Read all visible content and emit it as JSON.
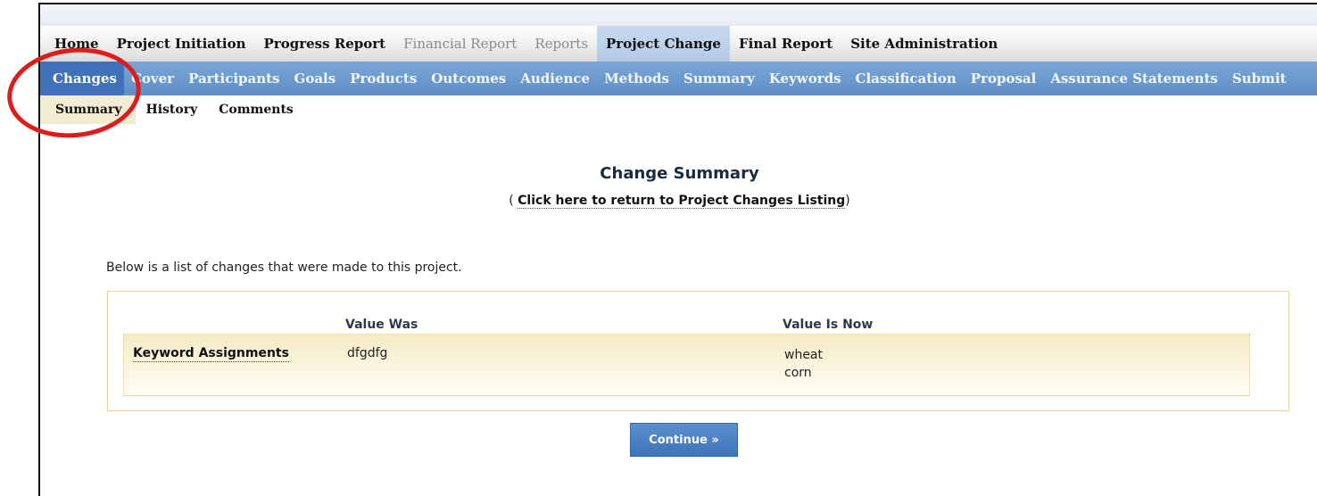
{
  "main_nav": [
    {
      "label": "Home",
      "state": "normal"
    },
    {
      "label": "Project Initiation",
      "state": "normal"
    },
    {
      "label": "Progress Report",
      "state": "normal"
    },
    {
      "label": "Financial Report",
      "state": "disabled"
    },
    {
      "label": "Reports",
      "state": "disabled"
    },
    {
      "label": "Project Change",
      "state": "active"
    },
    {
      "label": "Final Report",
      "state": "normal"
    },
    {
      "label": "Site Administration",
      "state": "normal"
    }
  ],
  "sub_nav": [
    {
      "label": "Changes",
      "active": true
    },
    {
      "label": "Cover",
      "active": false
    },
    {
      "label": "Participants",
      "active": false
    },
    {
      "label": "Goals",
      "active": false
    },
    {
      "label": "Products",
      "active": false
    },
    {
      "label": "Outcomes",
      "active": false
    },
    {
      "label": "Audience",
      "active": false
    },
    {
      "label": "Methods",
      "active": false
    },
    {
      "label": "Summary",
      "active": false
    },
    {
      "label": "Keywords",
      "active": false
    },
    {
      "label": "Classification",
      "active": false
    },
    {
      "label": "Proposal",
      "active": false
    },
    {
      "label": "Assurance Statements",
      "active": false
    },
    {
      "label": "Submit",
      "active": false
    }
  ],
  "tabs": [
    {
      "label": "Summary",
      "active": true
    },
    {
      "label": "History",
      "active": false
    },
    {
      "label": "Comments",
      "active": false
    }
  ],
  "content": {
    "title": "Change Summary",
    "return_prefix": "( ",
    "return_link": "Click here to return to Project Changes Listing",
    "return_suffix": ")",
    "intro": "Below is a list of changes that were made to this project.",
    "columns": {
      "was": "Value Was",
      "now": "Value Is Now"
    },
    "rows": [
      {
        "label": "Keyword Assignments",
        "was": [
          "dfgdfg"
        ],
        "now": [
          "wheat",
          "corn"
        ]
      }
    ],
    "continue_label": "Continue »"
  },
  "colors": {
    "subnav_blue": "#5e8ec6",
    "subnav_active": "#3f72b8",
    "annotation_red": "#e01b1b",
    "row_highlight": "#f4ebc6"
  }
}
